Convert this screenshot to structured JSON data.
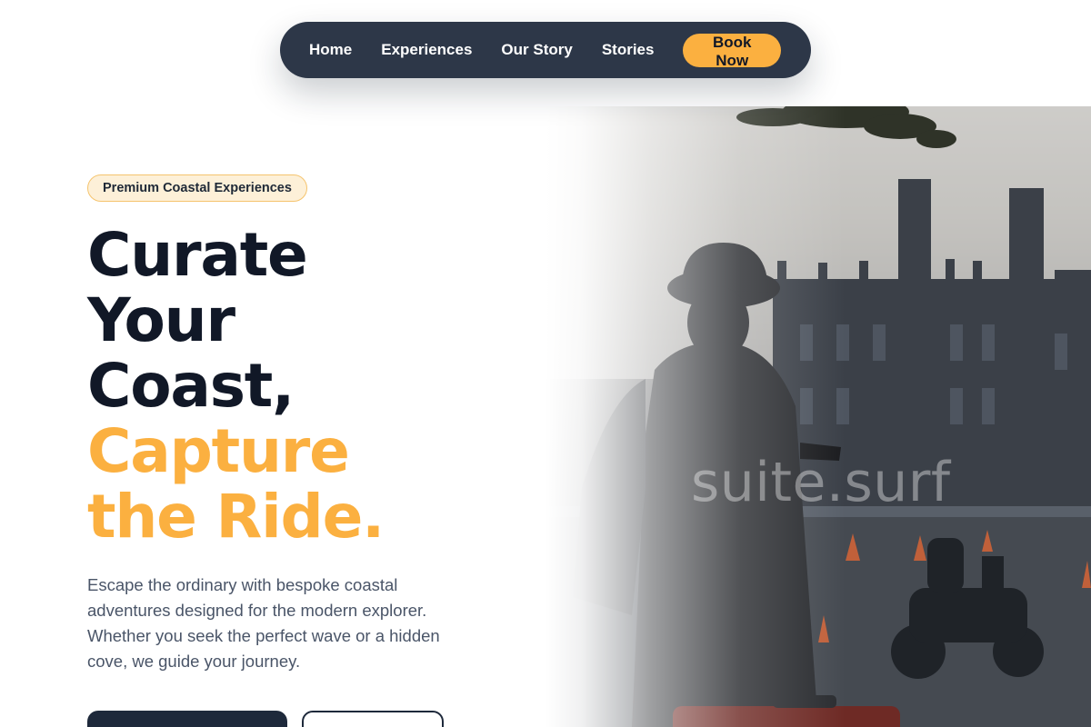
{
  "nav": {
    "items": [
      {
        "label": "Home"
      },
      {
        "label": "Experiences"
      },
      {
        "label": "Our Story"
      },
      {
        "label": "Stories"
      }
    ],
    "cta_label": "Book Now"
  },
  "hero": {
    "badge": "Premium Coastal Experiences",
    "headline_lines": [
      "Curate",
      "Your",
      "Coast,"
    ],
    "accent_lines": [
      "Capture",
      "the Ride."
    ],
    "description": "Escape the ordinary with bespoke coastal adventures designed for the modern explorer. Whether you seek the perfect wave or a hidden cove, we guide your journey.",
    "primary_cta": "",
    "secondary_cta": ""
  },
  "image": {
    "watermark": "suite.surf"
  },
  "colors": {
    "nav_bg": "#2d3748",
    "accent": "#fbb040",
    "heading": "#111827",
    "body_text": "#4a5568",
    "badge_bg": "#fdf0d8"
  }
}
